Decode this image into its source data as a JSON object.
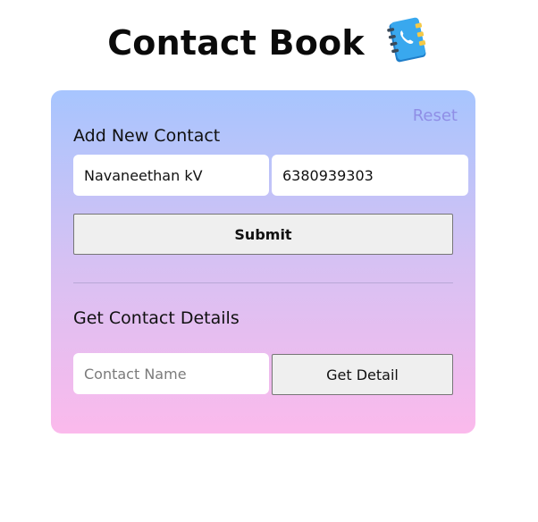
{
  "header": {
    "title": "Contact Book",
    "icon": "address-book-icon"
  },
  "card": {
    "reset_label": "Reset",
    "add_section": {
      "title": "Add New Contact",
      "name_value": "Navaneethan kV",
      "phone_value": "6380939303",
      "submit_label": "Submit"
    },
    "get_section": {
      "title": "Get Contact Details",
      "name_placeholder": "Contact Name",
      "button_label": "Get Detail"
    }
  },
  "colors": {
    "gradient_top": "#a7c5fe",
    "gradient_bottom": "#fbbaec",
    "reset_text": "#8f8ee6",
    "book_blue": "#2f9be6",
    "book_accent": "#f6c945"
  }
}
